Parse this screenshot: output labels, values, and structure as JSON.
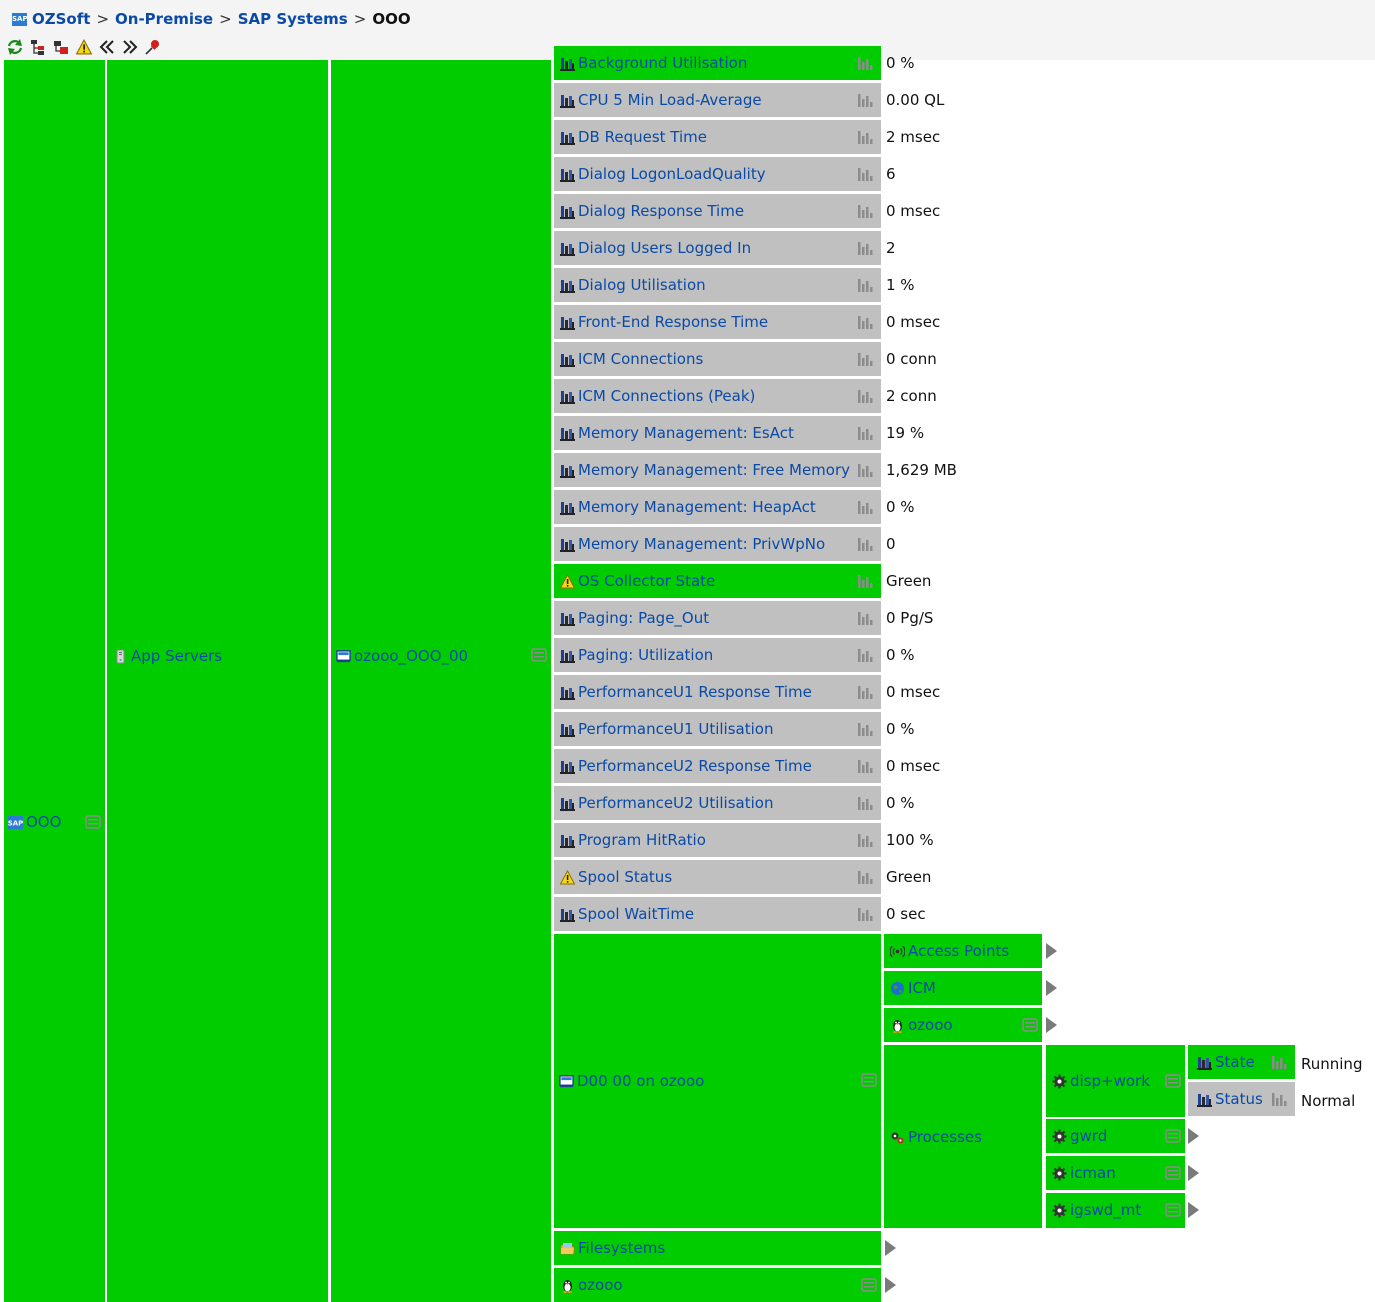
{
  "breadcrumb": {
    "items": [
      "OZSoft",
      "On-Premise",
      "SAP Systems"
    ],
    "separator": ">",
    "current": "OOO"
  },
  "toolbar": {
    "icons": [
      "refresh-icon",
      "tree-icon",
      "filter-icon",
      "warning-icon",
      "collapse-left-icon",
      "expand-right-icon",
      "pin-icon"
    ]
  },
  "colors": {
    "ok_green": "#00cc00",
    "neutral_gray": "#c0c0c0",
    "link_blue": "#0a4aa6"
  },
  "tree": {
    "root": {
      "label": "OOO"
    },
    "app_servers": {
      "label": "App Servers"
    },
    "instance": {
      "label": "ozooo_OOO_00"
    },
    "metrics": [
      {
        "label": "Background Utilisation",
        "value": "0 %",
        "status": "green",
        "icon": "metric-icon"
      },
      {
        "label": "CPU 5 Min Load-Average",
        "value": "0.00 QL",
        "status": "gray",
        "icon": "metric-icon"
      },
      {
        "label": "DB Request Time",
        "value": "2 msec",
        "status": "gray",
        "icon": "metric-icon"
      },
      {
        "label": "Dialog LogonLoadQuality",
        "value": "6",
        "status": "gray",
        "icon": "metric-icon"
      },
      {
        "label": "Dialog Response Time",
        "value": "0 msec",
        "status": "gray",
        "icon": "metric-icon"
      },
      {
        "label": "Dialog Users Logged In",
        "value": "2",
        "status": "gray",
        "icon": "metric-icon"
      },
      {
        "label": "Dialog Utilisation",
        "value": "1 %",
        "status": "gray",
        "icon": "metric-icon"
      },
      {
        "label": "Front-End Response Time",
        "value": "0 msec",
        "status": "gray",
        "icon": "metric-icon"
      },
      {
        "label": "ICM Connections",
        "value": "0 conn",
        "status": "gray",
        "icon": "metric-icon"
      },
      {
        "label": "ICM Connections (Peak)",
        "value": "2 conn",
        "status": "gray",
        "icon": "metric-icon"
      },
      {
        "label": "Memory Management: EsAct",
        "value": "19 %",
        "status": "gray",
        "icon": "metric-icon"
      },
      {
        "label": "Memory Management: Free Memory",
        "value": "1,629 MB",
        "status": "gray",
        "icon": "metric-icon"
      },
      {
        "label": "Memory Management: HeapAct",
        "value": "0 %",
        "status": "gray",
        "icon": "metric-icon"
      },
      {
        "label": "Memory Management: PrivWpNo",
        "value": "0",
        "status": "gray",
        "icon": "metric-icon"
      },
      {
        "label": "OS Collector State",
        "value": "Green",
        "status": "green",
        "icon": "warning-icon"
      },
      {
        "label": "Paging: Page_Out",
        "value": "0 Pg/S",
        "status": "gray",
        "icon": "metric-icon"
      },
      {
        "label": "Paging: Utilization",
        "value": "0 %",
        "status": "gray",
        "icon": "metric-icon"
      },
      {
        "label": "PerformanceU1 Response Time",
        "value": "0 msec",
        "status": "gray",
        "icon": "metric-icon"
      },
      {
        "label": "PerformanceU1 Utilisation",
        "value": "0 %",
        "status": "gray",
        "icon": "metric-icon"
      },
      {
        "label": "PerformanceU2 Response Time",
        "value": "0 msec",
        "status": "gray",
        "icon": "metric-icon"
      },
      {
        "label": "PerformanceU2 Utilisation",
        "value": "0 %",
        "status": "gray",
        "icon": "metric-icon"
      },
      {
        "label": "Program HitRatio",
        "value": "100 %",
        "status": "gray",
        "icon": "metric-icon"
      },
      {
        "label": "Spool Status",
        "value": "Green",
        "status": "gray",
        "icon": "warning-icon"
      },
      {
        "label": "Spool WaitTime",
        "value": "0 sec",
        "status": "gray",
        "icon": "metric-icon"
      }
    ],
    "d00": {
      "label": "D00 00 on ozooo",
      "children": {
        "access_points": "Access Points",
        "icm": "ICM",
        "host": "ozooo",
        "processes": "Processes"
      },
      "processes": {
        "disp_work": "disp+work",
        "gwrd": "gwrd",
        "icman": "icman",
        "igswd_mt": "igswd_mt"
      },
      "disp_work_metrics": {
        "state": {
          "label": "State",
          "value": "Running"
        },
        "status": {
          "label": "Status",
          "value": "Normal"
        }
      }
    },
    "filesystems": {
      "label": "Filesystems"
    },
    "host": {
      "label": "ozooo"
    }
  }
}
